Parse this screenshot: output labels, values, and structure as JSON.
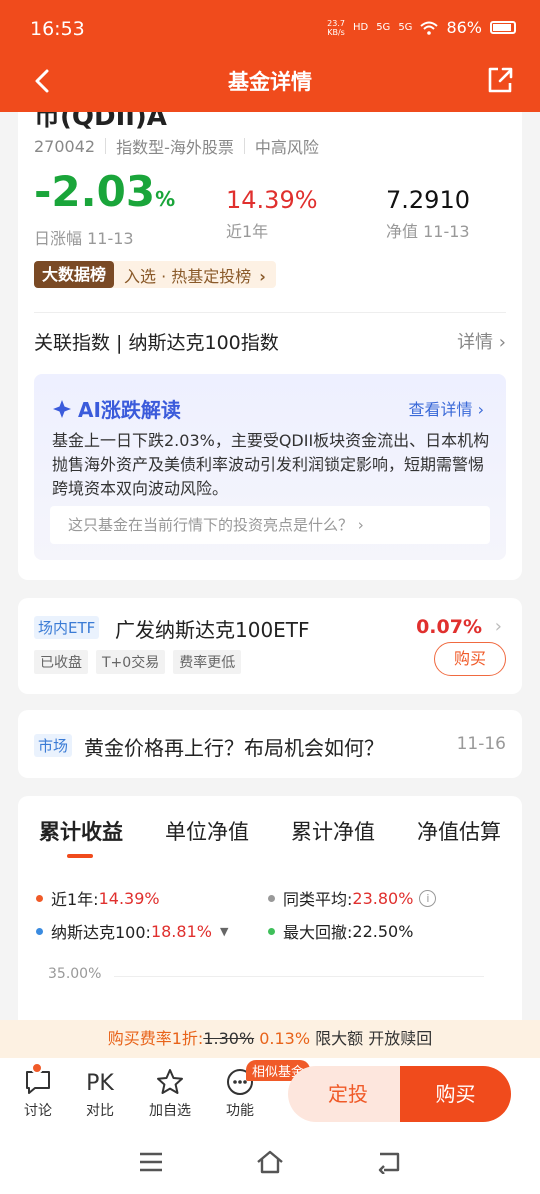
{
  "status": {
    "time": "16:53",
    "net_speed_top": "23.7",
    "net_speed_unit": "KB/s",
    "hd": "HD",
    "sig1": "5G",
    "sig2": "5G",
    "battery": "86%"
  },
  "nav": {
    "title": "基金详情"
  },
  "fund": {
    "name_partial": "币(QDII)A",
    "code": "270042",
    "type": "指数型-海外股票",
    "risk": "中高风险",
    "daily_change": "-2.03",
    "daily_change_unit": "%",
    "daily_label": "日涨幅 11-13",
    "year_return": "14.39%",
    "year_label": "近1年",
    "nav_value": "7.2910",
    "nav_label": "净值 11-13",
    "badge_tag": "大数据榜",
    "badge_text": "入选 · 热基定投榜",
    "index_row": "关联指数 | 纳斯达克100指数",
    "index_detail": "详情"
  },
  "ai": {
    "title": "AI涨跌解读",
    "more": "查看详情",
    "body": "基金上一日下跌2.03%，主要受QDII板块资金流出、日本机构抛售海外资产及美债利率波动引发利润锁定影响，短期需警惕跨境资本双向波动风险。",
    "question": "这只基金在当前行情下的投资亮点是什么？"
  },
  "etf": {
    "tag": "场内ETF",
    "name": "广发纳斯达克100ETF",
    "pct": "0.07%",
    "chips": [
      "已收盘",
      "T+0交易",
      "费率更低"
    ],
    "buy": "购买"
  },
  "market": {
    "tag": "市场",
    "title": "黄金价格再上行？布局机会如何？",
    "date": "11-16"
  },
  "chart_tabs": [
    "累计收益",
    "单位净值",
    "累计净值",
    "净值估算"
  ],
  "legend": {
    "year_label": "近1年:",
    "year_value": "14.39%",
    "peer_label": "同类平均:",
    "peer_value": "23.80%",
    "index_label": "纳斯达克100:",
    "index_value": "18.81%",
    "drawdown_label": "最大回撤:",
    "drawdown_value": "22.50%",
    "colors": {
      "year": "#f05a28",
      "peer": "#999999",
      "index": "#3a8be0",
      "drawdown": "#3fbf5a"
    }
  },
  "chart_axis": {
    "top_tick": "35.00%"
  },
  "fee": {
    "prefix": "购买费率1折:",
    "original": "1.30%",
    "current": "0.13%",
    "suffix": "限大额 开放赎回"
  },
  "bottom": {
    "discuss": "讨论",
    "compare_icon": "PK",
    "compare": "对比",
    "watch": "加自选",
    "func": "功能",
    "similar": "相似基金",
    "dingtou": "定投",
    "buy": "购买"
  }
}
